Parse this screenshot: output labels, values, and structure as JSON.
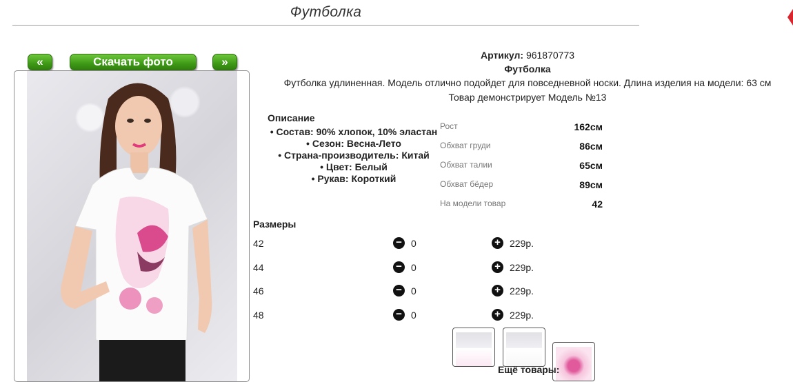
{
  "header": {
    "title": "Футболка"
  },
  "photo_controls": {
    "prev_label": "«",
    "next_label": "»",
    "download_label": "Скачать фото"
  },
  "product": {
    "article_label": "Артикул:",
    "article_value": "961870773",
    "name": "Футболка",
    "description": "Футболка удлиненная. Модель отлично подойдет для повседневной носки. Длина изделия на модели: 63 см",
    "model_note": "Товар демонстрирует Модель №13"
  },
  "description_section": {
    "heading": "Описание",
    "items": [
      "Состав: 90% хлопок, 10% эластан",
      "Сезон: Весна-Лето",
      "Страна-производитель: Китай",
      "Цвет: Белый",
      "Рукав: Короткий"
    ]
  },
  "model_params": [
    {
      "label": "Рост",
      "value": "162см"
    },
    {
      "label": "Обхват груди",
      "value": "86см"
    },
    {
      "label": "Обхват талии",
      "value": "65см"
    },
    {
      "label": "Обхват бёдер",
      "value": "89см"
    },
    {
      "label": "На модели товар",
      "value": "42"
    }
  ],
  "sizes": {
    "heading": "Размеры",
    "rows": [
      {
        "size": "42",
        "qty": "0",
        "price": "229р."
      },
      {
        "size": "44",
        "qty": "0",
        "price": "229р."
      },
      {
        "size": "46",
        "qty": "0",
        "price": "229р."
      },
      {
        "size": "48",
        "qty": "0",
        "price": "229р."
      }
    ]
  },
  "icons": {
    "minus": "minus-circle-icon",
    "plus": "plus-circle-icon"
  },
  "more_label": "Ещё товары:",
  "colors": {
    "button_green": "#3f9a17",
    "accent_pink": "#e05a9c"
  }
}
